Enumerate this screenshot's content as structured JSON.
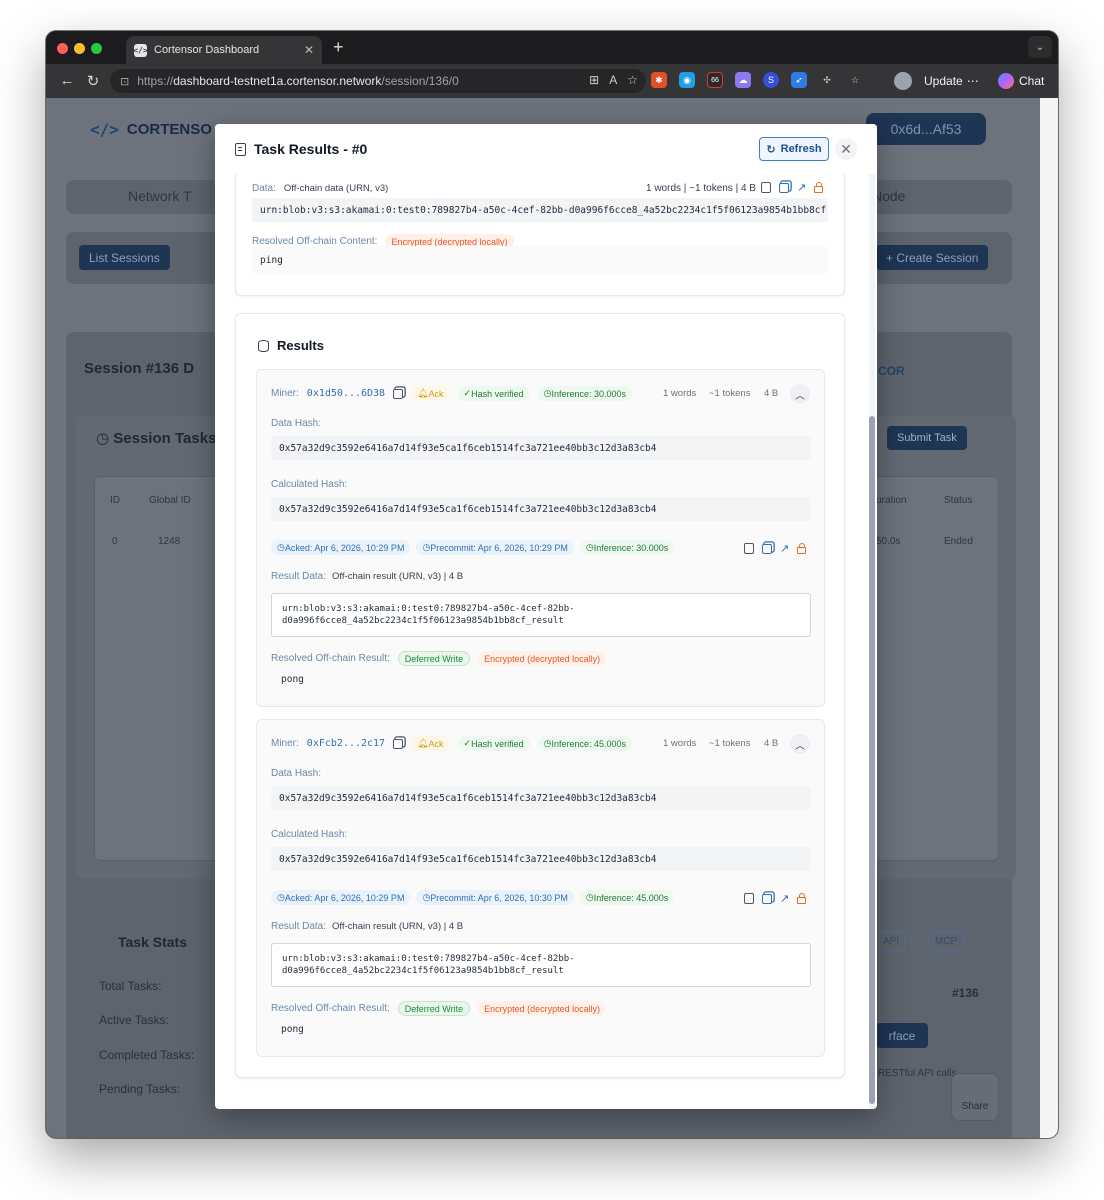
{
  "browser": {
    "tab_title": "Cortensor Dashboard",
    "url_prefix": "https://",
    "url_host": "dashboard-testnet1a.cortensor.network",
    "url_path": "/session/136/0",
    "update_label": "Update",
    "chat_label": "Chat",
    "ext_badge": "66"
  },
  "page": {
    "logo_text": "CORTENSO",
    "wallet": "0x6d...Af53",
    "tab_left": "Network T",
    "tab_right": "Node",
    "list_sessions": "List Sessions",
    "create_session": "+ Create Session",
    "session_title": "Session #136 D",
    "cor_label": "COR",
    "session_tasks": "Session Tasks",
    "submit_task": "Submit Task",
    "table_headers": {
      "id": "ID",
      "global_id": "Global ID",
      "duration": "uration",
      "status": "Status"
    },
    "table_row": {
      "id": "0",
      "global_id": "1248",
      "duration": "50.0s",
      "status": "Ended"
    },
    "task_stats": "Task Stats",
    "stats": [
      "Total Tasks:",
      "Active Tasks:",
      "Completed Tasks:",
      "Pending Tasks:"
    ],
    "api_label": "API",
    "mcp_label": "MCP",
    "session_num": "#136",
    "interface_label": "rface",
    "restful": "RESTful API calls",
    "share_label": "Share"
  },
  "modal": {
    "title": "Task Results - #0",
    "refresh_label": "Refresh",
    "data_label": "Data:",
    "data_desc": "Off-chain data (URN, v3)",
    "data_meta": "1 words | ~1 tokens | 4 B",
    "data_urn": "urn:blob:v3:s3:akamai:0:test0:789827b4-a50c-4cef-82bb-d0a996f6cce8_4a52bc2234c1f5f06123a9854b1bb8cf",
    "resolved_content_label": "Resolved Off-chain Content:",
    "encrypted_label": "Encrypted (decrypted locally)",
    "resolved_content": "ping",
    "results_title": "Results",
    "miners": [
      {
        "label": "Miner:",
        "address": "0x1d50...6D38",
        "ack": "Ack",
        "hash_verified": "Hash verified",
        "inference": "Inference: 30.000s",
        "words": "1 words",
        "tokens": "~1 tokens",
        "bytes": "4 B",
        "data_hash_label": "Data Hash:",
        "data_hash": "0x57a32d9c3592e6416a7d14f93e5ca1f6ceb1514fc3a721ee40bb3c12d3a83cb4",
        "calc_hash_label": "Calculated Hash:",
        "calc_hash": "0x57a32d9c3592e6416a7d14f93e5ca1f6ceb1514fc3a721ee40bb3c12d3a83cb4",
        "acked": "Acked: Apr 6, 2026, 10:29 PM",
        "precommit": "Precommit: Apr 6, 2026, 10:29 PM",
        "inference_pill": "Inference: 30.000s",
        "result_data_label": "Result Data:",
        "result_data_desc": "Off-chain result (URN, v3) | 4 B",
        "result_urn_line1": "urn:blob:v3:s3:akamai:0:test0:789827b4-a50c-4cef-82bb-",
        "result_urn_line2": "d0a996f6cce8_4a52bc2234c1f5f06123a9854b1bb8cf_result",
        "resolved_result_label": "Resolved Off-chain Result:",
        "deferred_write": "Deferred Write",
        "encrypted": "Encrypted (decrypted locally)",
        "resolved_result": "pong"
      },
      {
        "label": "Miner:",
        "address": "0xFcb2...2c17",
        "ack": "Ack",
        "hash_verified": "Hash verified",
        "inference": "Inference: 45.000s",
        "words": "1 words",
        "tokens": "~1 tokens",
        "bytes": "4 B",
        "data_hash_label": "Data Hash:",
        "data_hash": "0x57a32d9c3592e6416a7d14f93e5ca1f6ceb1514fc3a721ee40bb3c12d3a83cb4",
        "calc_hash_label": "Calculated Hash:",
        "calc_hash": "0x57a32d9c3592e6416a7d14f93e5ca1f6ceb1514fc3a721ee40bb3c12d3a83cb4",
        "acked": "Acked: Apr 6, 2026, 10:29 PM",
        "precommit": "Precommit: Apr 6, 2026, 10:30 PM",
        "inference_pill": "Inference: 45.000s",
        "result_data_label": "Result Data:",
        "result_data_desc": "Off-chain result (URN, v3) | 4 B",
        "result_urn_line1": "urn:blob:v3:s3:akamai:0:test0:789827b4-a50c-4cef-82bb-",
        "result_urn_line2": "d0a996f6cce8_4a52bc2234c1f5f06123a9854b1bb8cf_result",
        "resolved_result_label": "Resolved Off-chain Result:",
        "deferred_write": "Deferred Write",
        "encrypted": "Encrypted (decrypted locally)",
        "resolved_result": "pong"
      }
    ]
  },
  "colors": {
    "accent_blue": "#2f6fb2",
    "verified_green": "#1f8a3e",
    "encrypted_orange": "#e4572e",
    "ack_yellow": "#d39a1d"
  }
}
